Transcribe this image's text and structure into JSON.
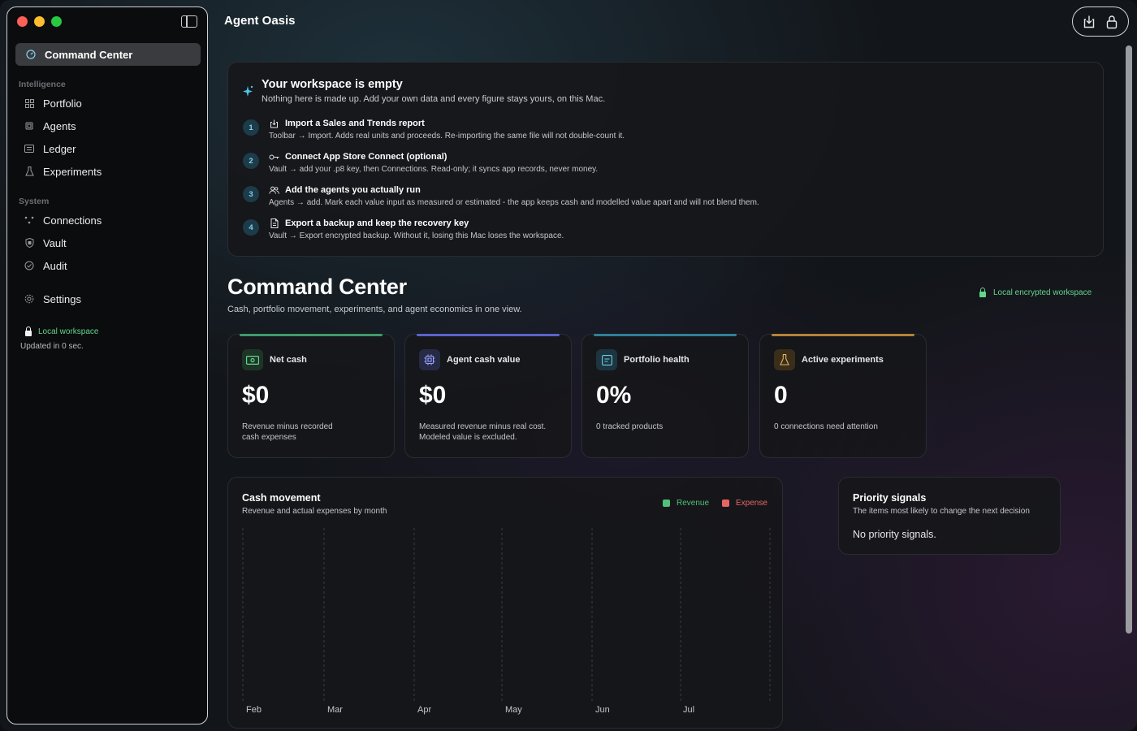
{
  "app": {
    "title": "Agent Oasis"
  },
  "toolbar": {
    "import_icon": "import-tray-icon",
    "lock_icon": "lock-icon"
  },
  "sidebar": {
    "active": {
      "label": "Command Center",
      "icon": "gauge-icon"
    },
    "sections": [
      {
        "title": "Intelligence",
        "items": [
          {
            "label": "Portfolio",
            "icon": "grid-icon"
          },
          {
            "label": "Agents",
            "icon": "cpu-icon"
          },
          {
            "label": "Ledger",
            "icon": "list-icon"
          },
          {
            "label": "Experiments",
            "icon": "flask-icon"
          }
        ]
      },
      {
        "title": "System",
        "items": [
          {
            "label": "Connections",
            "icon": "nodes-icon"
          },
          {
            "label": "Vault",
            "icon": "shield-icon"
          },
          {
            "label": "Audit",
            "icon": "check-circle-icon"
          }
        ]
      }
    ],
    "settings": {
      "label": "Settings",
      "icon": "gear-icon"
    },
    "status": {
      "local": "Local workspace",
      "updated": "Updated in 0 sec."
    }
  },
  "onboarding": {
    "title": "Your workspace is empty",
    "subtitle": "Nothing here is made up. Add your own data and every figure stays yours, on this Mac.",
    "steps": [
      {
        "num": "1",
        "title": "Import a Sales and Trends report",
        "desc": "Toolbar → Import. Adds real units and proceeds. Re-importing the same file will not double-count it.",
        "icon": "import-icon"
      },
      {
        "num": "2",
        "title": "Connect App Store Connect (optional)",
        "desc": "Vault → add your .p8 key, then Connections. Read-only; it syncs app records, never money.",
        "icon": "key-icon"
      },
      {
        "num": "3",
        "title": "Add the agents you actually run",
        "desc": "Agents → add. Mark each value input as measured or estimated - the app keeps cash and modelled value apart and will not blend them.",
        "icon": "people-icon"
      },
      {
        "num": "4",
        "title": "Export a backup and keep the recovery key",
        "desc": "Vault → Export encrypted backup. Without it, losing this Mac loses the workspace.",
        "icon": "document-icon"
      }
    ]
  },
  "command_center": {
    "title": "Command Center",
    "subtitle": "Cash, portfolio movement, experiments, and agent economics in one view.",
    "badge": "Local encrypted workspace"
  },
  "metrics": [
    {
      "label": "Net cash",
      "value": "$0",
      "desc": "Revenue minus recorded cash expenses",
      "accent": "#3f9a6a",
      "icon": "cash-icon"
    },
    {
      "label": "Agent cash value",
      "value": "$0",
      "desc": "Measured revenue minus real cost. Modeled value is excluded.",
      "accent": "#5a63c8",
      "icon": "cpu-icon"
    },
    {
      "label": "Portfolio health",
      "value": "0%",
      "desc": "0 tracked products",
      "accent": "#2f8096",
      "icon": "app-window-icon"
    },
    {
      "label": "Active experiments",
      "value": "0",
      "desc": "0 connections need attention",
      "accent": "#b38338",
      "icon": "flask-icon"
    }
  ],
  "cash_movement": {
    "title": "Cash movement",
    "subtitle": "Revenue and actual expenses by month",
    "legend": [
      {
        "name": "Revenue",
        "color": "#4fc17b"
      },
      {
        "name": "Expense",
        "color": "#e86565"
      }
    ]
  },
  "chart_data": {
    "type": "bar",
    "categories": [
      "Feb",
      "Mar",
      "Apr",
      "May",
      "Jun",
      "Jul"
    ],
    "series": [
      {
        "name": "Revenue",
        "values": [
          0,
          0,
          0,
          0,
          0,
          0
        ]
      },
      {
        "name": "Expense",
        "values": [
          0,
          0,
          0,
          0,
          0,
          0
        ]
      }
    ],
    "title": "Cash movement",
    "subtitle": "Revenue and actual expenses by month",
    "legend_position": "top-right",
    "grid": true
  },
  "priority": {
    "title": "Priority signals",
    "subtitle": "The items most likely to change the next decision",
    "empty": "No priority signals."
  }
}
